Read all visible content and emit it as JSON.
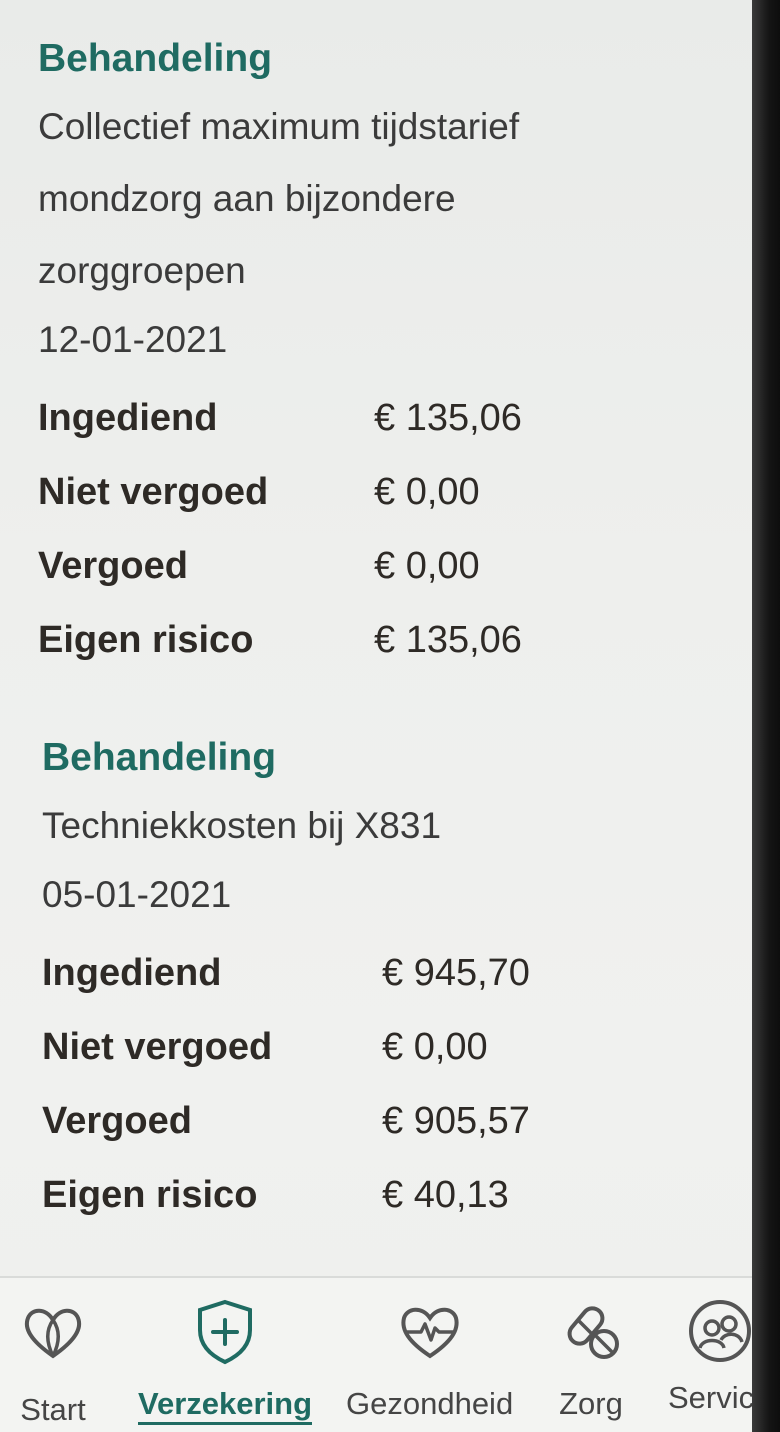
{
  "claims": [
    {
      "heading": "Behandeling",
      "description": "Collectief maximum tijdstarief mondzorg aan bijzondere zorggroepen",
      "date": "12-01-2021",
      "rows": [
        {
          "label": "Ingediend",
          "value": "€ 135,06"
        },
        {
          "label": "Niet vergoed",
          "value": "€ 0,00"
        },
        {
          "label": "Vergoed",
          "value": "€ 0,00"
        },
        {
          "label": "Eigen risico",
          "value": "€ 135,06"
        }
      ]
    },
    {
      "heading": "Behandeling",
      "description": "Techniekkosten bij X831",
      "date": "05-01-2021",
      "rows": [
        {
          "label": "Ingediend",
          "value": "€ 945,70"
        },
        {
          "label": "Niet vergoed",
          "value": "€ 0,00"
        },
        {
          "label": "Vergoed",
          "value": "€ 905,57"
        },
        {
          "label": "Eigen risico",
          "value": "€ 40,13"
        }
      ]
    }
  ],
  "nav": {
    "items": [
      {
        "label": "Start",
        "icon": "heart-outline-icon",
        "active": false
      },
      {
        "label": "Verzekering",
        "icon": "shield-plus-icon",
        "active": true
      },
      {
        "label": "Gezondheid",
        "icon": "heart-pulse-icon",
        "active": false
      },
      {
        "label": "Zorg",
        "icon": "pills-icon",
        "active": false
      },
      {
        "label": "Service",
        "icon": "people-icon",
        "active": false
      }
    ]
  },
  "colors": {
    "accent": "#1f6b62",
    "text": "#2e2a26",
    "background": "#eeefed"
  }
}
